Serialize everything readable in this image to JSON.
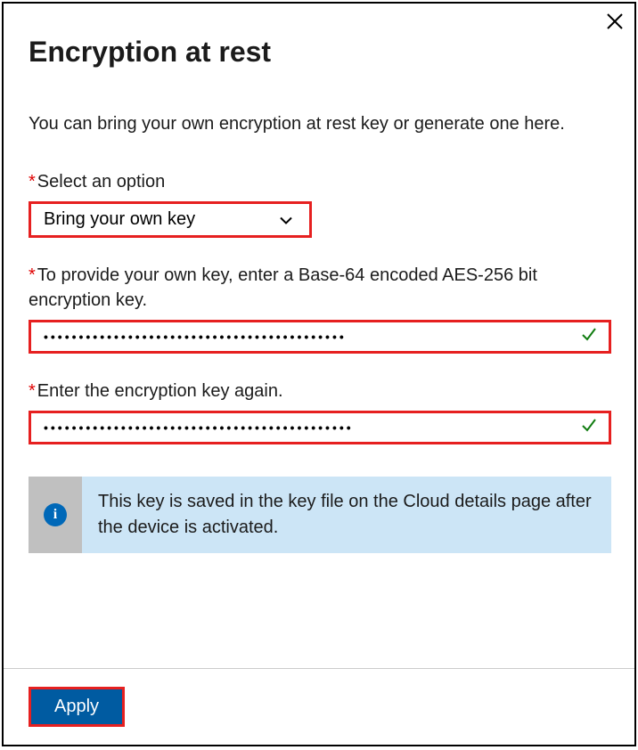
{
  "title": "Encryption at rest",
  "description": "You can bring your own encryption at rest key or generate one here.",
  "fields": {
    "option": {
      "label": "Select an option",
      "value": "Bring your own key"
    },
    "key": {
      "label": "To provide your own key, enter a Base-64 encoded AES-256 bit encryption key.",
      "masked": "•••••••••••••••••••••••••••••••••••••••••••"
    },
    "confirm": {
      "label": "Enter the encryption key again.",
      "masked": "••••••••••••••••••••••••••••••••••••••••••••"
    }
  },
  "info": "This key is saved in the key file on the Cloud details page after the device is activated.",
  "apply": "Apply"
}
